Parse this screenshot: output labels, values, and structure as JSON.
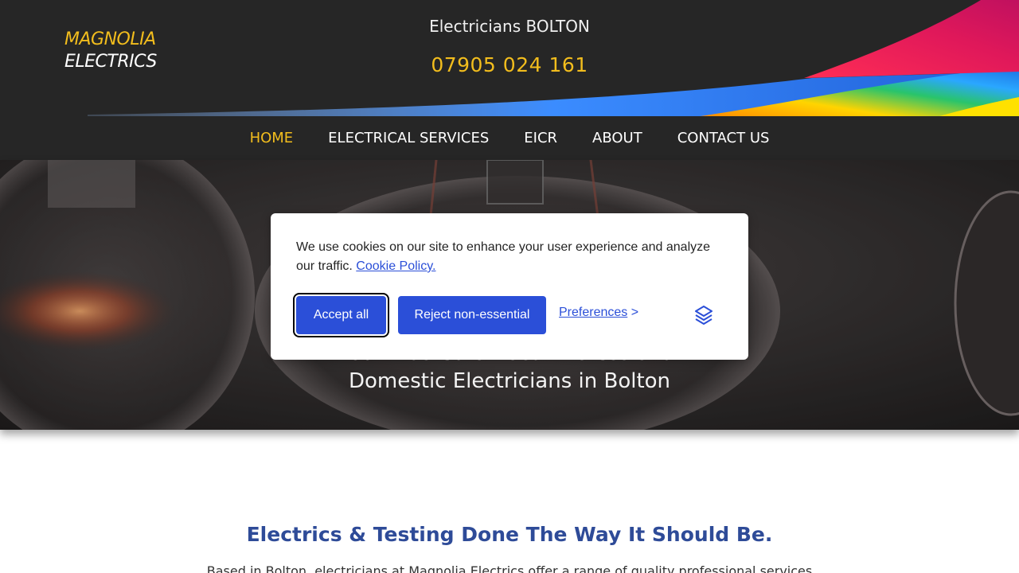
{
  "header": {
    "logo_line1": "MAGNOLIA",
    "logo_line2": "ELECTRICS",
    "title": "Electricians BOLTON",
    "phone": "07905 024 161"
  },
  "nav": {
    "items": [
      {
        "label": "HOME",
        "active": true
      },
      {
        "label": "ELECTRICAL SERVICES",
        "active": false
      },
      {
        "label": "EICR",
        "active": false
      },
      {
        "label": "ABOUT",
        "active": false
      },
      {
        "label": "CONTACT US",
        "active": false
      }
    ]
  },
  "hero": {
    "line1": "Your Trusted & Local Professional",
    "line2": "Domestic Electricians in Bolton"
  },
  "intro": {
    "heading": "Electrics & Testing Done The Way It Should Be.",
    "text": "Based in Bolton, electricians at Magnolia Electrics offer a range of quality professional services"
  },
  "cookie_banner": {
    "message": "We use cookies on our site to enhance your user experience and analyze our traffic.",
    "policy_link": "Cookie Policy.",
    "accept_label": "Accept all",
    "reject_label": "Reject non-essential",
    "preferences_label": "Preferences",
    "preferences_arrow": ">",
    "brand_icon": "layers-logo-icon"
  },
  "colors": {
    "header_bg": "#262626",
    "accent_yellow": "#f2bd1d",
    "button_blue": "#2b4fd8",
    "heading_blue": "#2e4b98"
  }
}
